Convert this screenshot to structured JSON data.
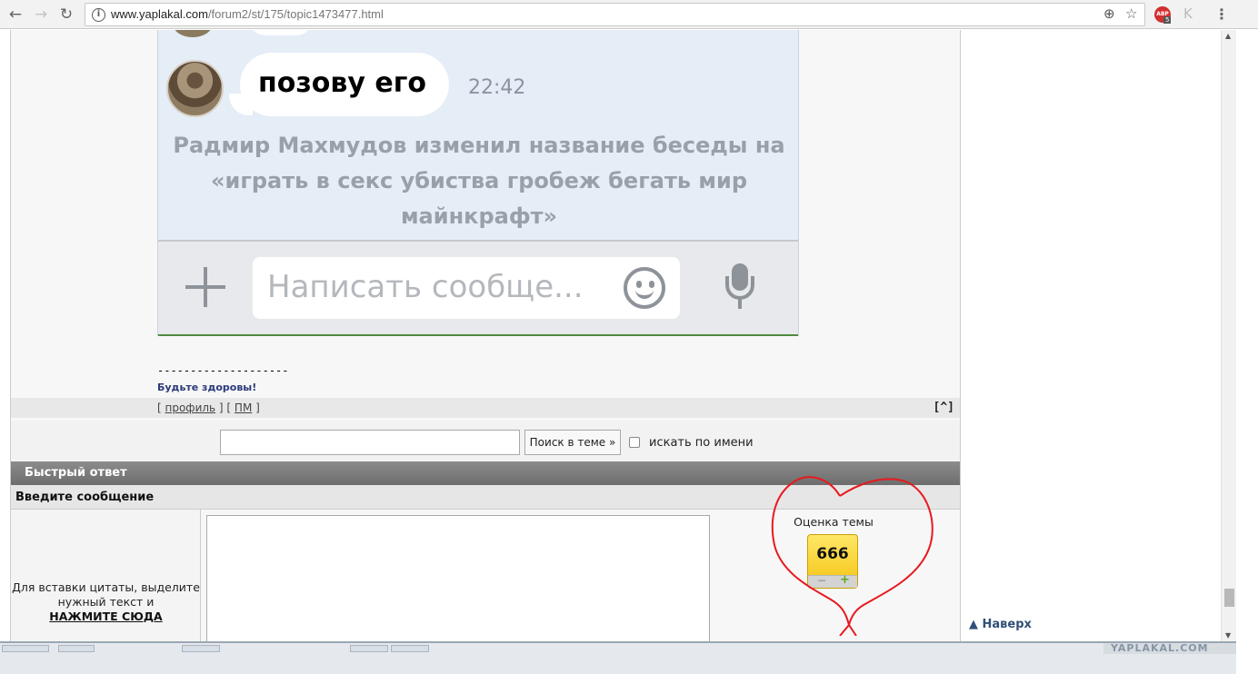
{
  "browser": {
    "url_host": "www.yaplakal.com",
    "url_path": "/forum2/st/175/topic1473477.html",
    "extension_badge": "ABP",
    "extension_count": "5"
  },
  "post": {
    "chat_message": "позову его",
    "chat_time": "22:42",
    "chat_service_message": "Радмир Махмудов изменил название беседы на «играть в секс убиства гробеж бегать мир майнкрафт»",
    "chat_input_placeholder": "Написать сообще...",
    "signature_separator": "--------------------",
    "signature": "Будьте здоровы!",
    "profile_link": "профиль",
    "pm_link": "ПМ",
    "top_link": "[^]"
  },
  "search": {
    "button_label": "Поиск в теме »",
    "by_name_label": "искать по имени"
  },
  "quick_reply": {
    "title": "Быстрый ответ",
    "subtitle": "Введите сообщение",
    "hint_text": "Для вставки цитаты, выделите нужный текст и",
    "hint_link": "НАЖМИТЕ СЮДА"
  },
  "rating": {
    "label": "Оценка темы",
    "value": "666"
  },
  "navigation": {
    "to_top": "Наверх"
  },
  "watermark": "YAPLAKAL.COM",
  "colors": {
    "chat_background": "#e5edf7",
    "section_header": "#7b7b7b",
    "rating_badge": "#f4c412",
    "annotation_heart": "#e8191e"
  },
  "icons": {
    "back": "back-arrow-icon",
    "forward": "forward-arrow-icon",
    "reload": "reload-icon",
    "zoom": "zoom-icon",
    "bookmark": "star-icon",
    "menu": "menu-dots-icon",
    "chat_add": "plus-icon",
    "chat_emoji": "smile-icon",
    "chat_voice": "microphone-icon"
  }
}
